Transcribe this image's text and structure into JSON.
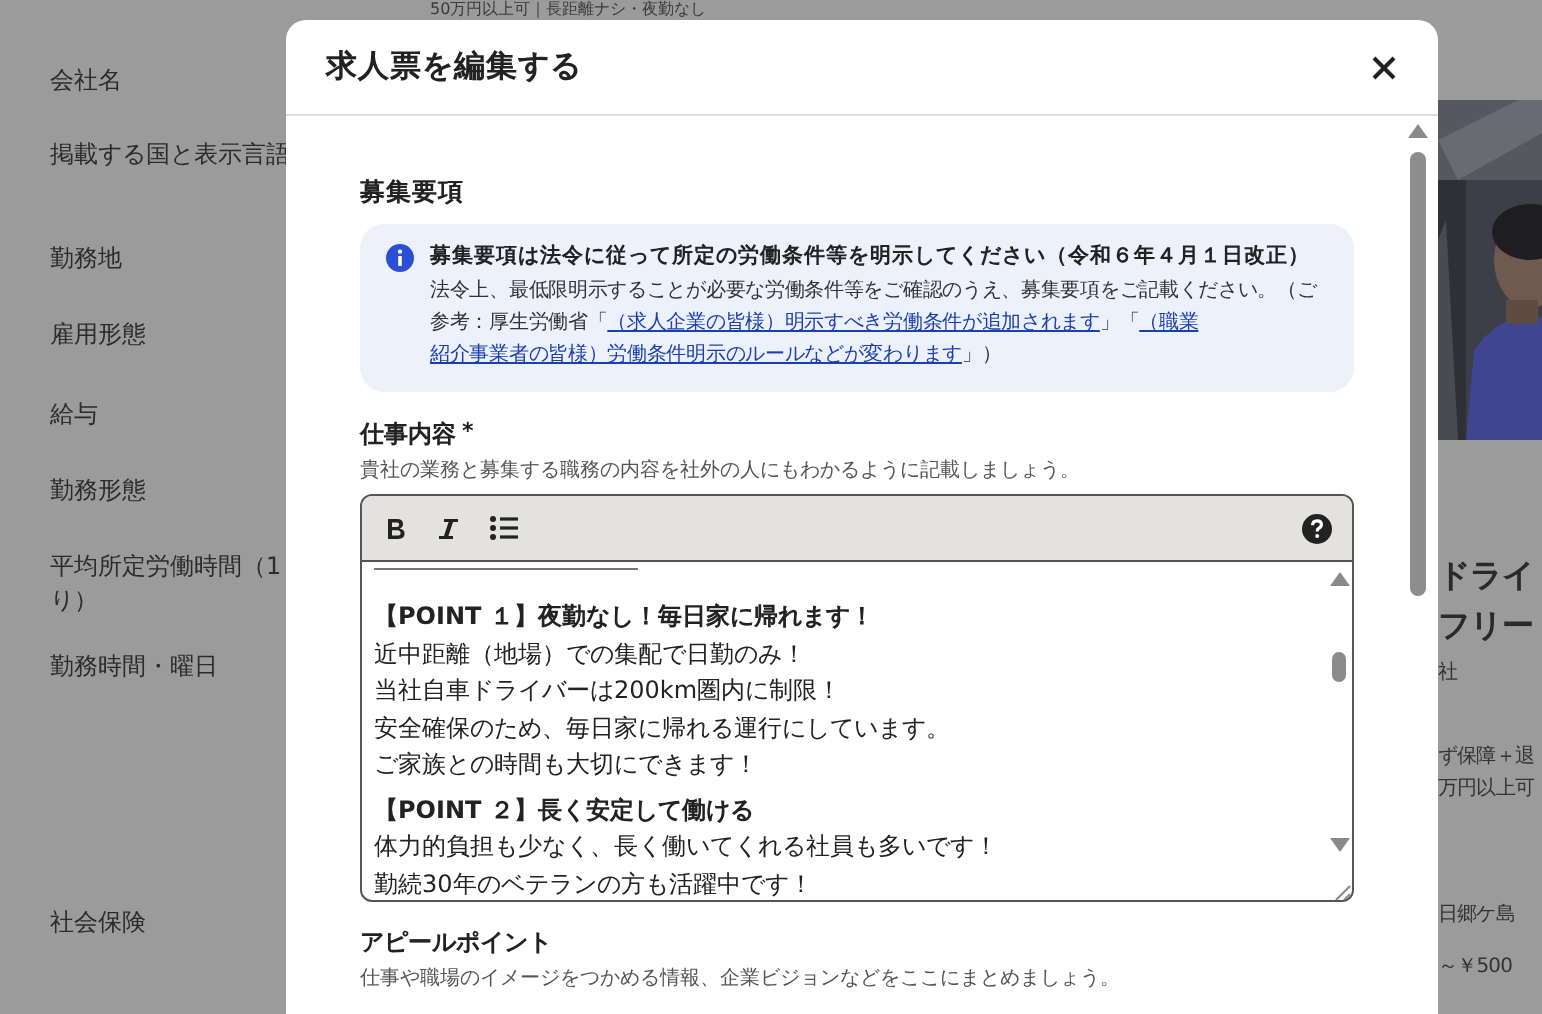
{
  "background": {
    "top_text": "50万円以上可｜長距離ナシ・夜勤なし",
    "labels": [
      [
        "会社名"
      ],
      [
        "掲載する国と表示言語"
      ],
      [
        "勤務地"
      ],
      [
        "雇用形態"
      ],
      [
        "給与"
      ],
      [
        "勤務形態"
      ],
      [
        "平均所定労働時間（1",
        "り）"
      ],
      [
        "勤務時間・曜日"
      ],
      [
        "社会保険"
      ]
    ],
    "right": {
      "title_lines": [
        "ドライ",
        "フリー"
      ],
      "company": "社",
      "tags": [
        "ず保障＋退",
        "万円以上可"
      ],
      "location": "日郷ケ島",
      "salary": "～￥500"
    }
  },
  "dialog": {
    "title": "求人票を編集する",
    "section_title": "募集要項",
    "notice": {
      "title": "募集要項は法令に従って所定の労働条件等を明示してください（令和６年４月１日改正）",
      "body": [
        {
          "kind": "text",
          "text": "法令上、最低限明示することが必要な労働条件等をご確認のうえ、募集要項をご記載ください。（ご参考：厚生労働省「"
        },
        {
          "kind": "link",
          "text": "（求人企業の皆様）明示すべき労働条件が追加されます"
        },
        {
          "kind": "text",
          "text": "」「"
        },
        {
          "kind": "link",
          "text": "（職業"
        },
        {
          "kind": "link",
          "text": "紹介事業者の皆様）労働条件明示のルールなどが変わります"
        },
        {
          "kind": "text",
          "text": "」）"
        }
      ]
    },
    "job_field": {
      "label": "仕事内容",
      "required_mark": "*",
      "hint": "貴社の業務と募集する職務の内容を社外の人にもわかるように記載しましょう。",
      "toolbar": [
        {
          "kind": "bold"
        },
        {
          "kind": "italic"
        },
        {
          "kind": "list"
        }
      ],
      "content": [
        {
          "kind": "rule"
        },
        {
          "kind": "heading",
          "text": "【POINT １】夜勤なし！毎日家に帰れます！"
        },
        {
          "kind": "text",
          "text": "近中距離（地場）での集配で日勤のみ！"
        },
        {
          "kind": "text",
          "text": "当社自車ドライバーは200km圏内に制限！"
        },
        {
          "kind": "text",
          "text": "安全確保のため、毎日家に帰れる運行にしています。"
        },
        {
          "kind": "text",
          "text": "ご家族との時間も大切にできます！"
        },
        {
          "kind": "heading",
          "text": "【POINT ２】長く安定して働ける"
        },
        {
          "kind": "text",
          "text": "体力的負担も少なく、長く働いてくれる社員も多いです！"
        },
        {
          "kind": "text",
          "text": "勤続30年のベテランの方も活躍中です！"
        }
      ]
    },
    "appeal_field": {
      "label": "アピールポイント",
      "hint": "仕事や職場のイメージをつかめる情報、企業ビジョンなどをここにまとめましょう。"
    }
  }
}
